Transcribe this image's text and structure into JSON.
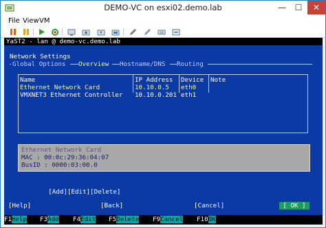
{
  "window": {
    "title": "DEMO-VC on esxi02.demo.lab",
    "minimize": "—",
    "maximize": "☐",
    "close": "✕"
  },
  "menu": [
    "File",
    "View",
    "VM"
  ],
  "toolbar_icons": [
    "pause-icon",
    "pause-alt-icon",
    "play-icon",
    "refresh-icon",
    "console-icon",
    "snapshot-icon",
    "revert-icon",
    "snapshot-manager-icon",
    "edit-icon",
    "settings-icon",
    "send-keys-icon",
    "network-icon"
  ],
  "yast": {
    "header": "YaST2 - lan @ demo-vc.demo.lab",
    "section_title": "Network Settings",
    "tabs": {
      "global": "Global Options",
      "overview": "Overview",
      "hostname": "Hostname/DNS",
      "routing": "Routing"
    },
    "table": {
      "columns": [
        "Name",
        "IP Address",
        "Device",
        "Note"
      ],
      "rows": [
        {
          "name": "Ethernet Network Card",
          "ip": "10.10.0.5",
          "device": "eth0",
          "note": ""
        },
        {
          "name": "VMXNET3 Ethernet Controller",
          "ip": "10.10.0.201",
          "device": "eth1",
          "note": ""
        }
      ]
    },
    "details": {
      "title": "Ethernet Network Card",
      "mac": "MAC : 00:0c:29:36:04:07",
      "busid": "BusID : 0000:03:00.0"
    },
    "actions": {
      "add": "[Add]",
      "edit": "[Edit]",
      "delete": "[Delete]"
    },
    "bottom": {
      "help": "[Help]",
      "back": "[Back]",
      "cancel": "[Cancel]",
      "ok": "[ OK ]"
    },
    "fkeys": [
      {
        "key": "F1",
        "label": "Help"
      },
      {
        "key": "F3",
        "label": "Add"
      },
      {
        "key": "F4",
        "label": "Edit"
      },
      {
        "key": "F5",
        "label": "Delete"
      },
      {
        "key": "F9",
        "label": "Cancel"
      },
      {
        "key": "F10",
        "label": "OK"
      }
    ]
  },
  "colors": {
    "console_bg": "#0b3aa5",
    "highlight": "#ffff55",
    "ok_button": "#1d9b63",
    "fkey_label": "#0fa3a3"
  }
}
